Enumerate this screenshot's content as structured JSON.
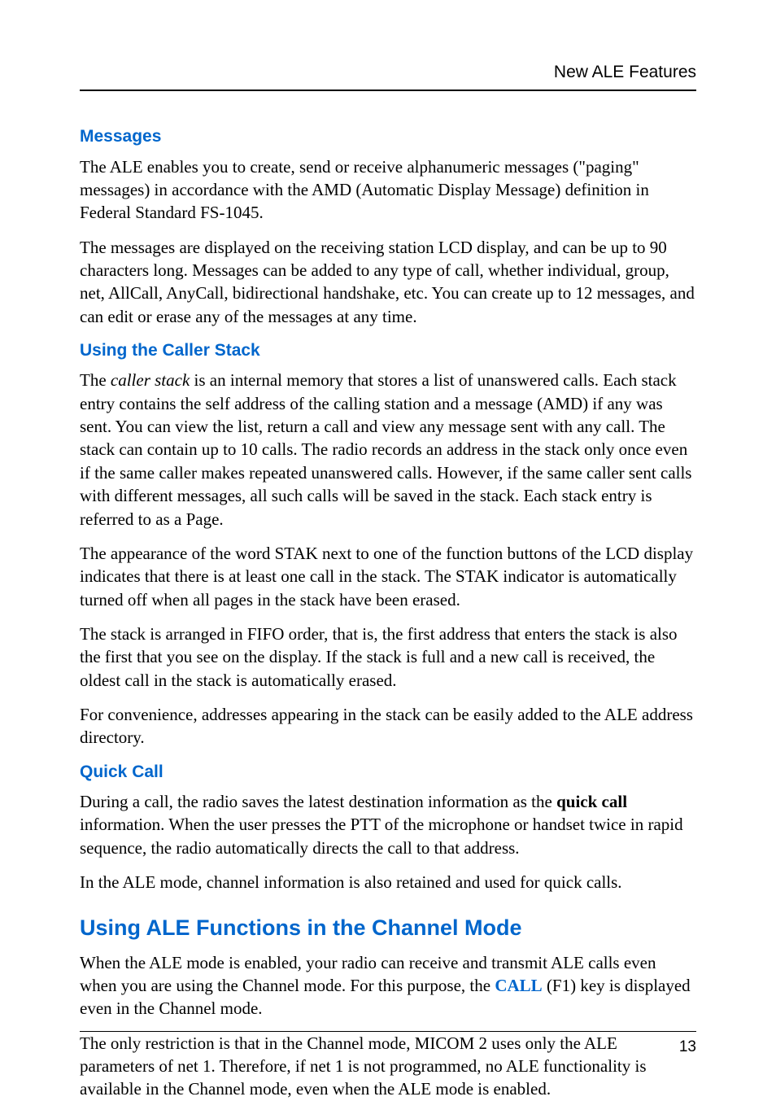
{
  "header": {
    "label": "New ALE Features"
  },
  "sections": {
    "messages": {
      "heading": "Messages",
      "p1": "The ALE enables you to create, send or receive alphanumeric messages (\"paging\" messages) in accordance with the AMD (Automatic Display Message) definition in Federal Standard FS-1045.",
      "p2": "The messages are displayed on the receiving station LCD display, and can be up to 90 characters long. Messages can be added to any type of call, whether individual, group, net, AllCall, AnyCall, bidirectional handshake, etc. You can create up to 12 messages, and can edit or erase any of the messages at any time."
    },
    "caller_stack": {
      "heading": "Using the Caller Stack",
      "p1_pre": "The ",
      "p1_italic": "caller stack",
      "p1_post": " is an internal memory that stores a list of unanswered calls. Each stack entry contains the self address of the calling station and a message (AMD) if any was sent. You can view the list, return a call and view any message sent with any call. The stack can contain up to 10 calls. The radio records an address in the stack only once even if the same caller makes repeated unanswered calls. However, if the same caller sent calls with different messages, all such calls will be saved in the stack. Each stack entry is referred to as a Page.",
      "p2": "The appearance of the word STAK next to one of the function buttons of the LCD display indicates that there is at least one call in the stack. The STAK indicator is automatically turned off when all pages in the stack have been erased.",
      "p3": "The stack is arranged in FIFO order, that is, the first address that enters the stack is also the first that you see on the display. If the stack is full and a new call is received, the oldest call in the stack is automatically erased.",
      "p4": "For convenience, addresses appearing in the stack can be easily added to the ALE address directory."
    },
    "quick_call": {
      "heading": "Quick Call",
      "p1_pre": "During a call, the radio saves the latest destination information as the ",
      "p1_bold": "quick call",
      "p1_post": " information. When the user presses the PTT of the microphone or handset twice in rapid sequence, the radio automatically directs the call to that address.",
      "p2": "In the ALE mode, channel information is also retained and used for quick calls."
    },
    "channel_mode": {
      "heading": "Using ALE Functions in the Channel Mode",
      "p1_pre": "When the ALE mode is enabled, your radio can receive and transmit ALE calls even when you are using the Channel mode. For this purpose, the ",
      "p1_key": "CALL",
      "p1_post": " (F1) key is displayed even in the Channel mode.",
      "p2": "The only restriction is that in the Channel mode, MICOM 2 uses only the ALE parameters of net 1. Therefore, if net 1 is not programmed, no ALE functionality is available in the Channel mode, even when the ALE mode is enabled."
    }
  },
  "footer": {
    "page_number": "13"
  }
}
